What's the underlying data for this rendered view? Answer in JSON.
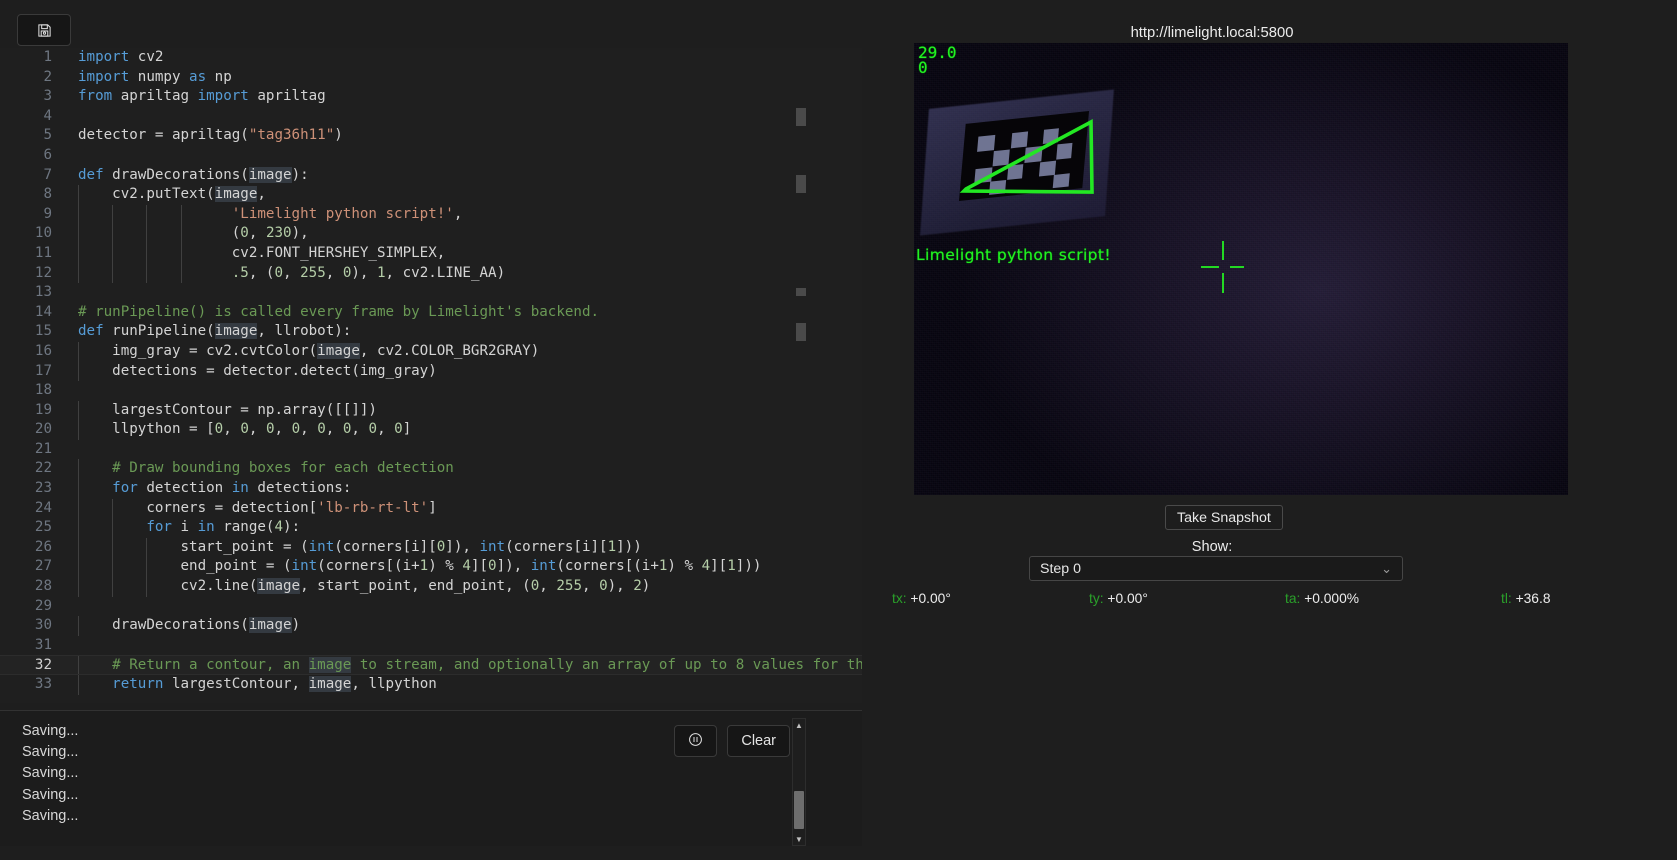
{
  "toolbar": {
    "save_icon": "save-disk-icon",
    "save_tooltip": "Save"
  },
  "editor": {
    "language": "python",
    "active_line": 32,
    "lines": [
      {
        "n": "1",
        "tokens": [
          {
            "t": "import",
            "c": "kw"
          },
          {
            "t": " cv2",
            "c": "pl"
          }
        ]
      },
      {
        "n": "2",
        "tokens": [
          {
            "t": "import",
            "c": "kw"
          },
          {
            "t": " numpy ",
            "c": "pl"
          },
          {
            "t": "as",
            "c": "kw"
          },
          {
            "t": " np",
            "c": "pl"
          }
        ]
      },
      {
        "n": "3",
        "tokens": [
          {
            "t": "from",
            "c": "kw"
          },
          {
            "t": " apriltag ",
            "c": "pl"
          },
          {
            "t": "import",
            "c": "kw"
          },
          {
            "t": " apriltag",
            "c": "pl"
          }
        ]
      },
      {
        "n": "4",
        "tokens": []
      },
      {
        "n": "5",
        "tokens": [
          {
            "t": "detector = apriltag(",
            "c": "pl"
          },
          {
            "t": "\"tag36h11\"",
            "c": "str"
          },
          {
            "t": ")",
            "c": "pl"
          }
        ]
      },
      {
        "n": "6",
        "tokens": []
      },
      {
        "n": "7",
        "tokens": [
          {
            "t": "def",
            "c": "kw"
          },
          {
            "t": " drawDecorations(",
            "c": "pl"
          },
          {
            "t": "image",
            "c": "sel"
          },
          {
            "t": "):",
            "c": "pl"
          }
        ]
      },
      {
        "n": "8",
        "tokens": [
          {
            "t": "    cv2.putText(",
            "c": "pl"
          },
          {
            "t": "image",
            "c": "sel"
          },
          {
            "t": ",",
            "c": "pl"
          }
        ]
      },
      {
        "n": "9",
        "tokens": [
          {
            "t": "                  ",
            "c": "pl"
          },
          {
            "t": "'Limelight python script!'",
            "c": "str"
          },
          {
            "t": ",",
            "c": "pl"
          }
        ]
      },
      {
        "n": "10",
        "tokens": [
          {
            "t": "                  (",
            "c": "pl"
          },
          {
            "t": "0",
            "c": "num"
          },
          {
            "t": ", ",
            "c": "pl"
          },
          {
            "t": "230",
            "c": "num"
          },
          {
            "t": "),",
            "c": "pl"
          }
        ]
      },
      {
        "n": "11",
        "tokens": [
          {
            "t": "                  cv2.FONT_HERSHEY_SIMPLEX,",
            "c": "pl"
          }
        ]
      },
      {
        "n": "12",
        "tokens": [
          {
            "t": "                  ",
            "c": "pl"
          },
          {
            "t": ".5",
            "c": "num"
          },
          {
            "t": ", (",
            "c": "pl"
          },
          {
            "t": "0",
            "c": "num"
          },
          {
            "t": ", ",
            "c": "pl"
          },
          {
            "t": "255",
            "c": "num"
          },
          {
            "t": ", ",
            "c": "pl"
          },
          {
            "t": "0",
            "c": "num"
          },
          {
            "t": "), ",
            "c": "pl"
          },
          {
            "t": "1",
            "c": "num"
          },
          {
            "t": ", cv2.LINE_AA)",
            "c": "pl"
          }
        ]
      },
      {
        "n": "13",
        "tokens": []
      },
      {
        "n": "14",
        "tokens": [
          {
            "t": "# runPipeline() is called every frame by Limelight's backend.",
            "c": "com"
          }
        ]
      },
      {
        "n": "15",
        "tokens": [
          {
            "t": "def",
            "c": "kw"
          },
          {
            "t": " runPipeline(",
            "c": "pl"
          },
          {
            "t": "image",
            "c": "sel"
          },
          {
            "t": ", llrobot):",
            "c": "pl"
          }
        ]
      },
      {
        "n": "16",
        "tokens": [
          {
            "t": "    img_gray = cv2.cvtColor(",
            "c": "pl"
          },
          {
            "t": "image",
            "c": "sel"
          },
          {
            "t": ", cv2.COLOR_BGR2GRAY)",
            "c": "pl"
          }
        ]
      },
      {
        "n": "17",
        "tokens": [
          {
            "t": "    detections = detector.detect(img_gray)",
            "c": "pl"
          }
        ]
      },
      {
        "n": "18",
        "tokens": []
      },
      {
        "n": "19",
        "tokens": [
          {
            "t": "    largestContour = np.array([[]])",
            "c": "pl"
          }
        ]
      },
      {
        "n": "20",
        "tokens": [
          {
            "t": "    llpython = [",
            "c": "pl"
          },
          {
            "t": "0",
            "c": "num"
          },
          {
            "t": ", ",
            "c": "pl"
          },
          {
            "t": "0",
            "c": "num"
          },
          {
            "t": ", ",
            "c": "pl"
          },
          {
            "t": "0",
            "c": "num"
          },
          {
            "t": ", ",
            "c": "pl"
          },
          {
            "t": "0",
            "c": "num"
          },
          {
            "t": ", ",
            "c": "pl"
          },
          {
            "t": "0",
            "c": "num"
          },
          {
            "t": ", ",
            "c": "pl"
          },
          {
            "t": "0",
            "c": "num"
          },
          {
            "t": ", ",
            "c": "pl"
          },
          {
            "t": "0",
            "c": "num"
          },
          {
            "t": ", ",
            "c": "pl"
          },
          {
            "t": "0",
            "c": "num"
          },
          {
            "t": "]",
            "c": "pl"
          }
        ]
      },
      {
        "n": "21",
        "tokens": []
      },
      {
        "n": "22",
        "tokens": [
          {
            "t": "    # Draw bounding boxes for each detection",
            "c": "com"
          }
        ]
      },
      {
        "n": "23",
        "tokens": [
          {
            "t": "    ",
            "c": "pl"
          },
          {
            "t": "for",
            "c": "kw"
          },
          {
            "t": " detection ",
            "c": "pl"
          },
          {
            "t": "in",
            "c": "kw"
          },
          {
            "t": " detections:",
            "c": "pl"
          }
        ]
      },
      {
        "n": "24",
        "tokens": [
          {
            "t": "        corners = detection[",
            "c": "pl"
          },
          {
            "t": "'lb-rb-rt-lt'",
            "c": "str"
          },
          {
            "t": "]",
            "c": "pl"
          }
        ]
      },
      {
        "n": "25",
        "tokens": [
          {
            "t": "        ",
            "c": "pl"
          },
          {
            "t": "for",
            "c": "kw"
          },
          {
            "t": " i ",
            "c": "pl"
          },
          {
            "t": "in",
            "c": "kw"
          },
          {
            "t": " range(",
            "c": "pl"
          },
          {
            "t": "4",
            "c": "num"
          },
          {
            "t": "):",
            "c": "pl"
          }
        ]
      },
      {
        "n": "26",
        "tokens": [
          {
            "t": "            start_point = (",
            "c": "pl"
          },
          {
            "t": "int",
            "c": "kw"
          },
          {
            "t": "(corners[i][",
            "c": "pl"
          },
          {
            "t": "0",
            "c": "num"
          },
          {
            "t": "]), ",
            "c": "pl"
          },
          {
            "t": "int",
            "c": "kw"
          },
          {
            "t": "(corners[i][",
            "c": "pl"
          },
          {
            "t": "1",
            "c": "num"
          },
          {
            "t": "]))",
            "c": "pl"
          }
        ]
      },
      {
        "n": "27",
        "tokens": [
          {
            "t": "            end_point = (",
            "c": "pl"
          },
          {
            "t": "int",
            "c": "kw"
          },
          {
            "t": "(corners[(i+",
            "c": "pl"
          },
          {
            "t": "1",
            "c": "num"
          },
          {
            "t": ") % ",
            "c": "pl"
          },
          {
            "t": "4",
            "c": "num"
          },
          {
            "t": "][",
            "c": "pl"
          },
          {
            "t": "0",
            "c": "num"
          },
          {
            "t": "]), ",
            "c": "pl"
          },
          {
            "t": "int",
            "c": "kw"
          },
          {
            "t": "(corners[(i+",
            "c": "pl"
          },
          {
            "t": "1",
            "c": "num"
          },
          {
            "t": ") % ",
            "c": "pl"
          },
          {
            "t": "4",
            "c": "num"
          },
          {
            "t": "][",
            "c": "pl"
          },
          {
            "t": "1",
            "c": "num"
          },
          {
            "t": "]))",
            "c": "pl"
          }
        ]
      },
      {
        "n": "28",
        "tokens": [
          {
            "t": "            cv2.line(",
            "c": "pl"
          },
          {
            "t": "image",
            "c": "sel"
          },
          {
            "t": ", start_point, end_point, (",
            "c": "pl"
          },
          {
            "t": "0",
            "c": "num"
          },
          {
            "t": ", ",
            "c": "pl"
          },
          {
            "t": "255",
            "c": "num"
          },
          {
            "t": ", ",
            "c": "pl"
          },
          {
            "t": "0",
            "c": "num"
          },
          {
            "t": "), ",
            "c": "pl"
          },
          {
            "t": "2",
            "c": "num"
          },
          {
            "t": ")",
            "c": "pl"
          }
        ]
      },
      {
        "n": "29",
        "tokens": []
      },
      {
        "n": "30",
        "tokens": [
          {
            "t": "    drawDecorations(",
            "c": "pl"
          },
          {
            "t": "image",
            "c": "sel"
          },
          {
            "t": ")",
            "c": "pl"
          }
        ]
      },
      {
        "n": "31",
        "tokens": []
      },
      {
        "n": "32",
        "tokens": [
          {
            "t": "    # Return a contour, an ",
            "c": "com"
          },
          {
            "t": "image",
            "c": "sel com"
          },
          {
            "t": " to stream, and optionally an array of up to 8 values for th",
            "c": "com"
          }
        ]
      },
      {
        "n": "33",
        "tokens": [
          {
            "t": "    ",
            "c": "pl"
          },
          {
            "t": "return",
            "c": "kw"
          },
          {
            "t": " largestContour, ",
            "c": "pl"
          },
          {
            "t": "image",
            "c": "sel"
          },
          {
            "t": ", llpython",
            "c": "pl"
          }
        ]
      }
    ]
  },
  "console": {
    "lines": [
      "Saving...",
      "Saving...",
      "Saving...",
      "Saving...",
      "Saving..."
    ],
    "pause_icon": "pause-circle-icon",
    "clear_label": "Clear",
    "scroll_up_icon": "caret-up-icon",
    "scroll_down_icon": "caret-down-icon"
  },
  "stream": {
    "url": "http://limelight.local:5800",
    "overlay_fps": "29.0\n0",
    "overlay_script_text": "Limelight python script!",
    "crosshair_icon": "crosshair-icon",
    "take_snapshot_label": "Take Snapshot",
    "show_label": "Show:",
    "show_selected": "Step 0",
    "show_chevron_icon": "chevron-down-icon",
    "accent_green": "#23f023",
    "stats": [
      {
        "key": "tx:",
        "value": "+0.00°"
      },
      {
        "key": "ty:",
        "value": "+0.00°"
      },
      {
        "key": "ta:",
        "value": "+0.000%"
      },
      {
        "key": "tl:",
        "value": "+36.8"
      }
    ]
  }
}
